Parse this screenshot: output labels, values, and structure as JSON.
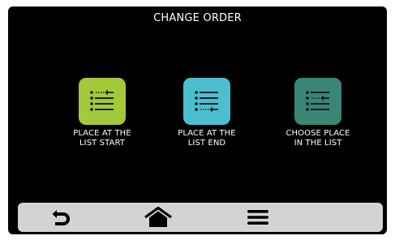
{
  "screen": {
    "title": "CHANGE ORDER"
  },
  "options": [
    {
      "label": "PLACE AT THE\nLIST START",
      "icon": "list-place-start-icon",
      "color": "#a2c93a"
    },
    {
      "label": "PLACE AT THE\nLIST END",
      "icon": "list-place-end-icon",
      "color": "#4bbfd0"
    },
    {
      "label": "CHOOSE PLACE\nIN THE LIST",
      "icon": "list-choose-place-icon",
      "color": "#3a8574"
    }
  ],
  "bottom_bar": {
    "buttons": [
      {
        "icon": "back-arrow-icon"
      },
      {
        "icon": "home-icon"
      },
      {
        "icon": "menu-icon"
      }
    ]
  }
}
